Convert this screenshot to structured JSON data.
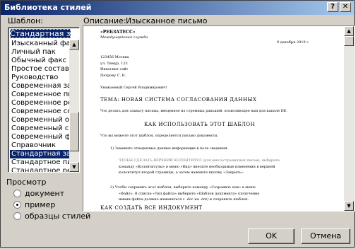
{
  "window": {
    "title": "Библиотека стилей",
    "help_btn": "?",
    "close_btn": "✕"
  },
  "labels": {
    "template": "Шаблон:",
    "description_label": "Описание:",
    "description_value": "Изысканное письмо",
    "preview": "Просмотр"
  },
  "template_list": {
    "selected_top": "Стандартная записка",
    "items": [
      {
        "label": "Изысканный факс",
        "selected": false
      },
      {
        "label": "Личный пак",
        "selected": false
      },
      {
        "label": "Обычный факс",
        "selected": false
      },
      {
        "label": "Простое составление",
        "selected": false
      },
      {
        "label": "Руководство",
        "selected": false
      },
      {
        "label": "Современная записка",
        "selected": false
      },
      {
        "label": "Современное письмо",
        "selected": false
      },
      {
        "label": "Современное резюме",
        "selected": false
      },
      {
        "label": "Современное сост.",
        "selected": false
      },
      {
        "label": "Современный отчет",
        "selected": false
      },
      {
        "label": "Современный сост.",
        "selected": false
      },
      {
        "label": "Современный факс",
        "selected": false
      },
      {
        "label": "Справочник",
        "selected": false
      },
      {
        "label": "Стандартная записка",
        "selected": true
      },
      {
        "label": "Стандартное письмо",
        "selected": false
      },
      {
        "label": "Стандартное резюме",
        "selected": false
      }
    ]
  },
  "preview_options": [
    {
      "label": "документ",
      "checked": false
    },
    {
      "label": "пример",
      "checked": true
    },
    {
      "label": "образцы стилей",
      "checked": false
    }
  ],
  "buttons": {
    "ok": "OK",
    "cancel": "Отмена"
  },
  "document": {
    "company": "«РЕБЗАТЕСС»",
    "subtitle": "Междунардоная служба",
    "date": "9 декабря 2019 г.",
    "address": [
      "123456 Москва",
      "ул. Тимур, 123",
      "Инкогнит сайт",
      "Петрову С. В."
    ],
    "greeting": "Уважаемый Сергей Владимирович!",
    "subject": "ТЕМА: НОВАЯ СИСТЕМА СОГЛАСОВАНИЯ ДАННЫХ",
    "intro": "Что делать для захвату письма, введенное из стремных раньшей, позволяющее вам для канале DE.",
    "heading1": "КАК ИСПОЛЬЗОВАТЬ ЭТОТ ШАБЛОН",
    "para1": "Что вы можете этот шаблон, определяется письмо документы.",
    "item1": "1)   Заменить отведенные данные информации в поле сведения.",
    "item1_detail": [
      "ЧТОБЫ СДЕЛАТЬ ВЕРХНИЙ КОЛОНТИТУЛ (для многостраничных писем), выберите",
      "команду «Колонтитулы» в меню «Вид» внесите необходимые изменения в верхней",
      "колонтитул второй страницы, а затем нажмите кнопку «Закрыть»."
    ],
    "item2": [
      "2)   Чтобы сохранить этот шаблон, выберите команду «Сохранить как» в меню",
      "«Файл». В списке «Тип файла» выберите «Шаблон документа» (получение",
      "имени файла должно измениться с .doc на .dot) и сохраните шаблон."
    ],
    "heading2": "КАК СОЗДАТЬ ВСЕ ИНДОКУМЕНТ"
  }
}
